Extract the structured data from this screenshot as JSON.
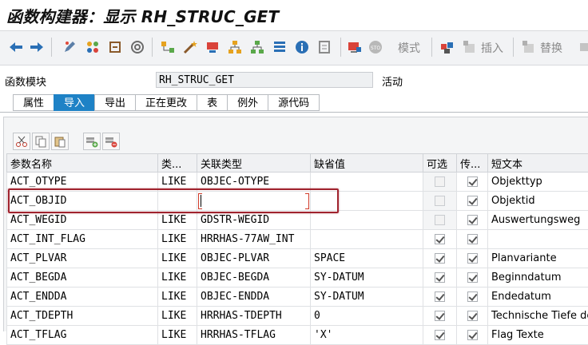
{
  "title": "函数构建器：显示 RH_STRUC_GET",
  "toolbar": {
    "mode_label": "模式",
    "insert_label": "插入",
    "replace_label": "替换"
  },
  "function_module": {
    "label": "函数模块",
    "value": "RH_STRUC_GET",
    "status": "活动"
  },
  "tabs": [
    "属性",
    "导入",
    "导出",
    "正在更改",
    "表",
    "例外",
    "源代码"
  ],
  "active_tab": "导入",
  "table": {
    "headers": [
      "参数名称",
      "类...",
      "关联类型",
      "缺省值",
      "可选",
      "传...",
      "短文本"
    ],
    "rows": [
      {
        "name": "ACT_OTYPE",
        "typing": "LIKE",
        "assoc": "OBJEC-OTYPE",
        "default": "",
        "optional": false,
        "optional_disabled": true,
        "pass": true,
        "short": "Objekttyp"
      },
      {
        "name": "ACT_OBJID",
        "typing": "",
        "assoc": "",
        "default": "",
        "optional": false,
        "optional_disabled": true,
        "pass": true,
        "short": "Objektid"
      },
      {
        "name": "ACT_WEGID",
        "typing": "LIKE",
        "assoc": "GDSTR-WEGID",
        "default": "",
        "optional": false,
        "optional_disabled": true,
        "pass": true,
        "short": "Auswertungsweg"
      },
      {
        "name": "ACT_INT_FLAG",
        "typing": "LIKE",
        "assoc": "HRRHAS-77AW_INT",
        "default": "",
        "optional": true,
        "optional_disabled": false,
        "pass": true,
        "short": ""
      },
      {
        "name": "ACT_PLVAR",
        "typing": "LIKE",
        "assoc": "OBJEC-PLVAR",
        "default": "SPACE",
        "optional": true,
        "optional_disabled": false,
        "pass": true,
        "short": "Planvariante"
      },
      {
        "name": "ACT_BEGDA",
        "typing": "LIKE",
        "assoc": "OBJEC-BEGDA",
        "default": "SY-DATUM",
        "optional": true,
        "optional_disabled": false,
        "pass": true,
        "short": "Beginndatum"
      },
      {
        "name": "ACT_ENDDA",
        "typing": "LIKE",
        "assoc": "OBJEC-ENDDA",
        "default": "SY-DATUM",
        "optional": true,
        "optional_disabled": false,
        "pass": true,
        "short": "Endedatum"
      },
      {
        "name": "ACT_TDEPTH",
        "typing": "LIKE",
        "assoc": "HRRHAS-TDEPTH",
        "default": "0",
        "optional": true,
        "optional_disabled": false,
        "pass": true,
        "short": "Technische Tiefe des"
      },
      {
        "name": "ACT_TFLAG",
        "typing": "LIKE",
        "assoc": "HRRHAS-TFLAG",
        "default": "'X'",
        "optional": true,
        "optional_disabled": false,
        "pass": true,
        "short": "Flag Texte"
      }
    ]
  },
  "colors": {
    "active_tab": "#1e82c6",
    "highlight_box": "#a0232e",
    "edit_brackets": "#d13b2a"
  }
}
